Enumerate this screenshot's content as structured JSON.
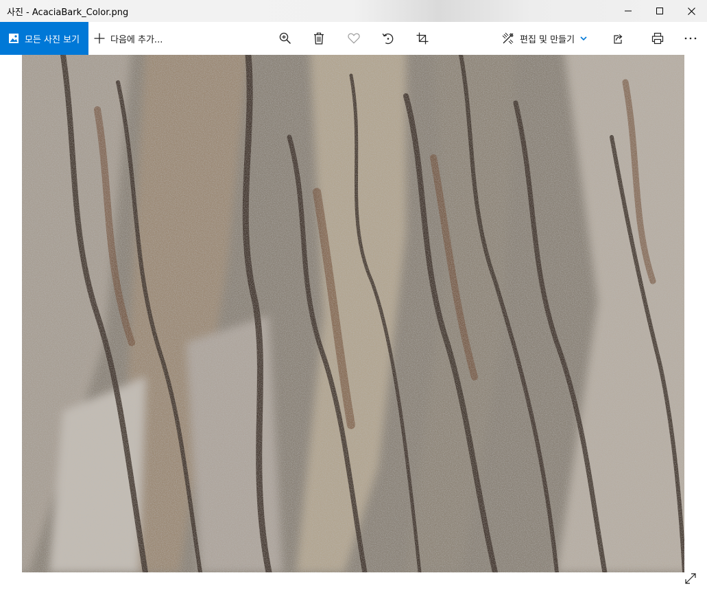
{
  "window": {
    "title": "사진 - AcaciaBark_Color.png",
    "controls": [
      "minimize-icon",
      "maximize-icon",
      "close-icon"
    ]
  },
  "toolbar": {
    "all_photos_label": "모든 사진 보기",
    "all_photos_icon": "image-icon",
    "add_to_label": "다음에 추가...",
    "add_to_icon": "plus-icon",
    "tools": [
      "zoom-in-icon",
      "delete-icon",
      "favorite-icon",
      "rotate-icon",
      "crop-icon"
    ],
    "edit_label": "편집 및 만들기",
    "edit_icon": "edit-create-icon",
    "right_tools": [
      "share-icon",
      "print-icon",
      "more-icon"
    ],
    "accent_color": "#0078d7"
  },
  "viewer": {
    "image_icon": "expand-icon"
  }
}
